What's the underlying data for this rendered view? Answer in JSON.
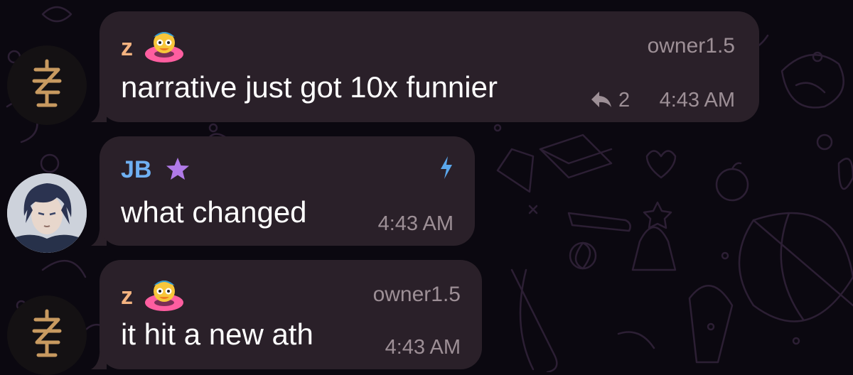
{
  "chat": {
    "messages": [
      {
        "sender": "z",
        "sender_color": "#f4b380",
        "badge_icon": "duck-swim-ring-emoji",
        "role": "owner1.5",
        "text": "narrative just got 10x funnier",
        "reply_count": "2",
        "time": "4:43 AM",
        "avatar_icon": "z-rune-avatar"
      },
      {
        "sender": "JB",
        "sender_color": "#6fb0f2",
        "badge_icon": "purple-star-icon",
        "status_icon": "lightning-bolt-icon",
        "text": "what changed",
        "time": "4:43 AM",
        "avatar_icon": "anime-character-avatar"
      },
      {
        "sender": "z",
        "sender_color": "#f4b380",
        "badge_icon": "duck-swim-ring-emoji",
        "role": "owner1.5",
        "text": "it hit a new ath",
        "time": "4:43 AM",
        "avatar_icon": "z-rune-avatar"
      }
    ]
  }
}
